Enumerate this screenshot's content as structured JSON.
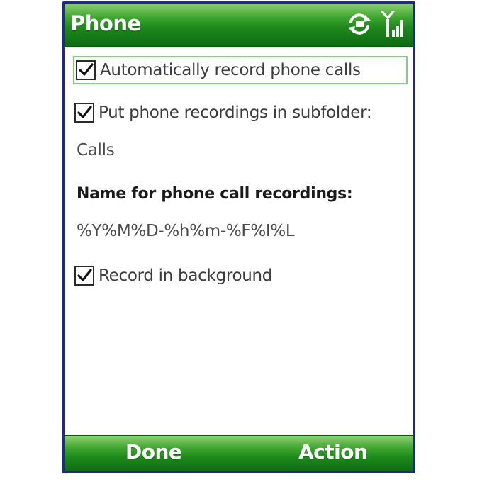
{
  "window": {
    "title": "Phone"
  },
  "status_icons": [
    "sync-icon",
    "signal-strength-icon"
  ],
  "settings": {
    "auto_record": {
      "label": "Automatically record phone calls",
      "checked": true
    },
    "subfolder": {
      "label": "Put phone recordings in subfolder:",
      "checked": true,
      "value": "Calls"
    },
    "name_format": {
      "label": "Name for phone call recordings:",
      "value": "%Y%M%D-%h%m-%F%I%L"
    },
    "background": {
      "label": "Record in background",
      "checked": true
    }
  },
  "softkeys": {
    "left": "Done",
    "right": "Action"
  },
  "colors": {
    "frame": "#1f2a86",
    "titlebar_green": "#1f8a1d",
    "focus_border": "#7fd07a"
  }
}
